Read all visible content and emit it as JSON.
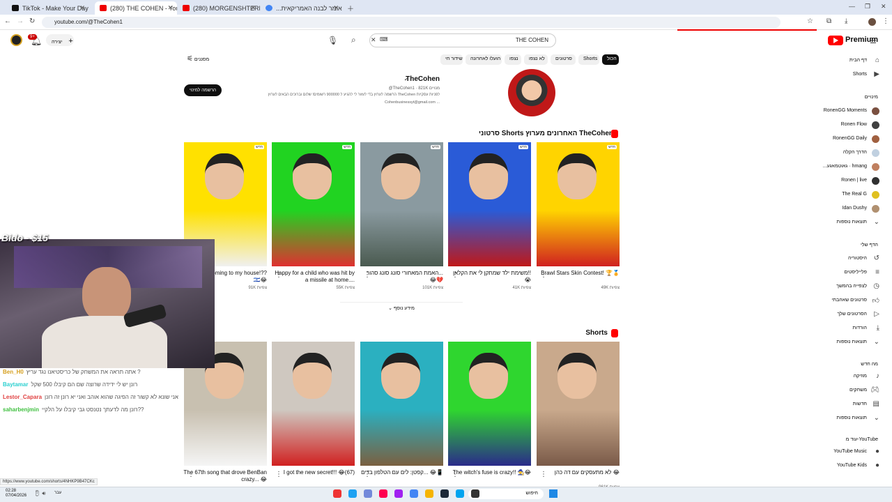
{
  "browser": {
    "tabs": [
      {
        "title": "TikTok - Make Your Day",
        "color": "#111"
      },
      {
        "title": "(280) THE COHEN - YouTube",
        "color": "#e00"
      },
      {
        "title": "(280) MORGENSHTERN - ARIST...",
        "color": "#e00"
      },
      {
        "title": "...הנאס אומר לבנה האמריקאית",
        "color": "#4285f4"
      }
    ],
    "url": "youtube.com/@TheCohen1"
  },
  "yt": {
    "search_value": "THE COHEN",
    "create_label": "יצירה",
    "notif_count": "9+",
    "logo_text": "Premium",
    "chips": [
      "הכול",
      "Shorts",
      "סרטונים",
      "לא נצפו",
      "נצפו",
      "הועלו לאחרונה",
      "שידור חי"
    ],
    "filter_label": "מסננים",
    "channel": {
      "name": "TheCohen",
      "handle": "@TheCohen1 · 821K מנויים",
      "desc": "הרשמה לערוץ בדי לעזור לי להגיע ל 900000 רשומים! שלום וברוכים הבאים לערוץ TheCohen לפניות עסקיות",
      "email": "Cohenbusinessyt@gmail.com ...",
      "subscribe": "הרשמה למינוי"
    },
    "section1_title": "סרטוני Shorts האחרונים מערוץ TheCohen",
    "section2_title": "Shorts",
    "show_more": "מידע נוסף",
    "new_badge": "חדש",
    "row1": [
      {
        "title": "Brawl Stars Skin Contest! 🏆🏅",
        "views": "49K צפיות",
        "c1": "#ffd400",
        "c2": "#d02020"
      },
      {
        "title": "משימת ילד שמתקן לי את הקלאן!! 😭",
        "views": "41K צפיות",
        "c1": "#2a5bd7",
        "c2": "#c01818"
      },
      {
        "title": "האמת המאחורי סונג סונג סהור... 😂💔",
        "views": "101K צפיות",
        "c1": "#8a9aa0",
        "c2": "#4a5a50"
      },
      {
        "title": "Happy for a child who was hit by a missile at home....",
        "views": "55K צפיות",
        "c1": "#21d321",
        "c2": "#e03030"
      },
      {
        "title": "Israel is coming to my house!?? 🇮🇱😂",
        "views": "91K צפיות",
        "c1": "#ffe100",
        "c2": "#f0f0f0"
      }
    ],
    "row2": [
      {
        "title": "לא מתעסקים עם דה כהן 😂",
        "views": "961K צפיות",
        "c1": "#c9a98c",
        "c2": "#7a5a48"
      },
      {
        "title": "The witch's fuse is crazy!! 🧙😂",
        "views": "",
        "c1": "#2fd62f",
        "c2": "#2a2a8a"
      },
      {
        "title": "קפטן: לים עם הטלפון בדים... 😂📱",
        "views": "",
        "c1": "#2bb0c0",
        "c2": "#7a6040"
      },
      {
        "title": "I got the new secret!!! 😂(67)",
        "views": "",
        "c1": "#cfc8c0",
        "c2": "#d02020"
      },
      {
        "title": "The 67th song that drove BenBan crazy... 😂",
        "views": "",
        "c1": "#c8c0b0",
        "c2": "#f5f5f5"
      }
    ]
  },
  "sidebar": {
    "home": "דף הבית",
    "shorts": "Shorts",
    "subs_header": "מינויים",
    "subs": [
      "RonenGG Moments",
      "Ronen Flow",
      "RonenGG Daily",
      "הדרך הקלה",
      "...גאוטמאגע · hmang",
      "Ronen | live",
      "The Real G",
      "Idan Dushy"
    ],
    "more": "תוצאות נוספות",
    "you_header": "הדף שלי",
    "you_items": [
      "היסטוריה",
      "פלייליסטים",
      "לצפייה בהמשך",
      "סרטונים שאהבתי",
      "הסרטונים שלך",
      "הורדות",
      "תוצאות נוספות"
    ],
    "explore_header": "מה חדש",
    "explore_items": [
      "מוזיקה",
      "משחקים",
      "חדשות",
      "תוצאות נוספות"
    ],
    "more_yt_header": "עוד מ-YouTube",
    "more_yt_items": [
      "YouTube Music",
      "YouTube Kids"
    ]
  },
  "stream": {
    "donation": "Bido - $15",
    "chat": [
      {
        "user": "Ben_H0",
        "msg": "אתה תראה את המשחק של כריסטיאנו נגד עריץ ?",
        "color": "#d6a020"
      },
      {
        "user": "Baytamar",
        "msg": "רונן יש לי ידידה שרוצה שם הם קיבלו 500 שקל",
        "color": "#2ad0d0"
      },
      {
        "user": "Lestor_Capara",
        "msg": "אני שונא לא קשור זה הפיגה שהוא אוהב ואני יא רונן זה רונן",
        "color": "#e04040"
      },
      {
        "user": "saharbenjmin",
        "msg": "רונן מה לדעתך נטנסט גבי קיבלו על הלקיי??",
        "color": "#40c040"
      }
    ]
  },
  "status_url": "https://www.youtube.com/shorts/4NHKP9B47CKc",
  "taskbar": {
    "time": "02:28",
    "date": "07/04/2026",
    "search": "חיפוש",
    "lang": "עבר"
  }
}
